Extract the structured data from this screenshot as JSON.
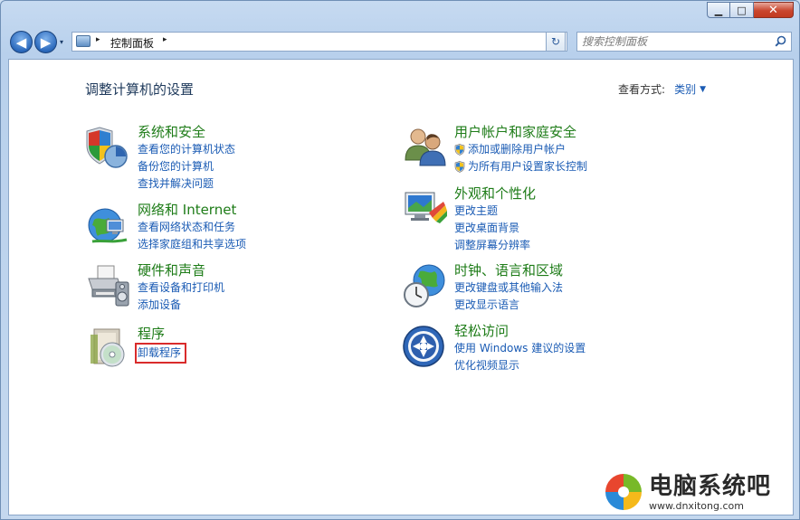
{
  "window": {
    "min_label": "▁",
    "max_label": "□",
    "close_label": "✕"
  },
  "nav": {
    "back_label": "◀",
    "forward_label": "▶",
    "dropdown_label": "▾",
    "address_crumb": "控制面板",
    "address_sep": "▸",
    "refresh_label": "↻",
    "search_placeholder": "搜索控制面板"
  },
  "main": {
    "heading": "调整计算机的设置",
    "view_by_label": "查看方式:",
    "view_by_value": "类别",
    "view_by_arrow": "▼"
  },
  "categories": [
    {
      "title": "系统和安全",
      "links": [
        "查看您的计算机状态",
        "备份您的计算机",
        "查找并解决问题"
      ]
    },
    {
      "title": "网络和 Internet",
      "links": [
        "查看网络状态和任务",
        "选择家庭组和共享选项"
      ]
    },
    {
      "title": "硬件和声音",
      "links": [
        "查看设备和打印机",
        "添加设备"
      ]
    },
    {
      "title": "程序",
      "links": [
        "卸载程序"
      ]
    },
    {
      "title": "用户帐户和家庭安全",
      "links": [
        "添加或删除用户帐户",
        "为所有用户设置家长控制"
      ]
    },
    {
      "title": "外观和个性化",
      "links": [
        "更改主题",
        "更改桌面背景",
        "调整屏幕分辨率"
      ]
    },
    {
      "title": "时钟、语言和区域",
      "links": [
        "更改键盘或其他输入法",
        "更改显示语言"
      ]
    },
    {
      "title": "轻松访问",
      "links": [
        "使用 Windows 建议的设置",
        "优化视频显示"
      ]
    }
  ],
  "watermark": {
    "name": "电脑系统吧",
    "url": "www.dnxitong.com"
  },
  "colors": {
    "category_title": "#1e7c18",
    "link": "#1a5bb4",
    "highlight_box": "#d92b2b"
  }
}
